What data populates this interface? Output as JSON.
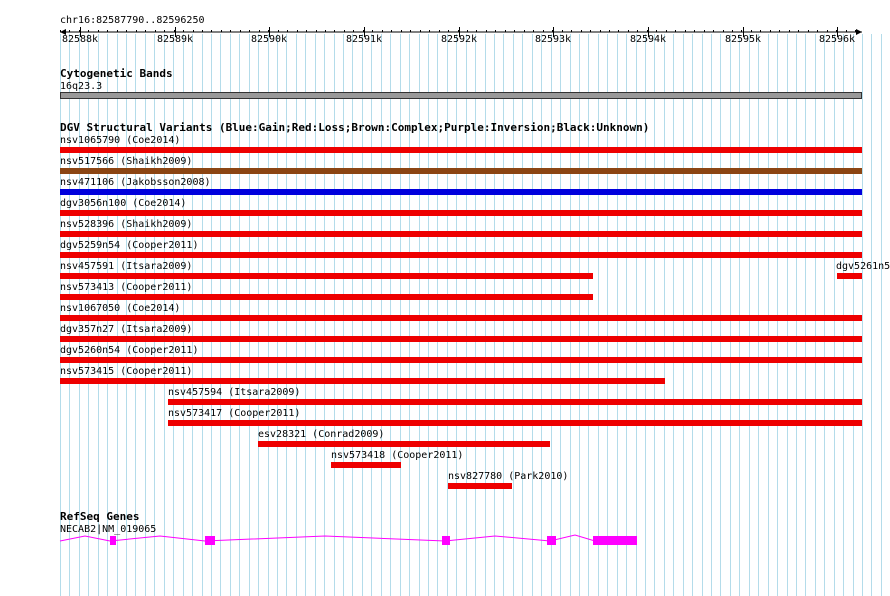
{
  "ruler": {
    "location": "chr16:82587790..82596250",
    "ticks": [
      "82588k",
      "82589k",
      "82590k",
      "82591k",
      "82592k",
      "82593k",
      "82594k",
      "82595k",
      "82596k"
    ]
  },
  "cytoband": {
    "title": "Cytogenetic Bands",
    "band": "16q23.3"
  },
  "dgv": {
    "title": "DGV Structural Variants (Blue:Gain;Red:Loss;Brown:Complex;Purple:Inversion;Black:Unknown)",
    "colors": {
      "loss": "#ee0000",
      "gain": "#0000dd",
      "complex": "#8b4513"
    },
    "variants": [
      {
        "label": "nsv1065790 (Coe2014)",
        "type": "loss"
      },
      {
        "label": "nsv517566 (Shaikh2009)",
        "type": "complex"
      },
      {
        "label": "nsv471106 (Jakobsson2008)",
        "type": "gain"
      },
      {
        "label": "dgv3056n100 (Coe2014)",
        "type": "loss"
      },
      {
        "label": "nsv528396 (Shaikh2009)",
        "type": "loss"
      },
      {
        "label": "dgv5259n54 (Cooper2011)",
        "type": "loss"
      },
      {
        "label": "nsv457591 (Itsara2009)",
        "type": "loss"
      },
      {
        "label": "dgv5261n5",
        "type": "loss"
      },
      {
        "label": "nsv573413 (Cooper2011)",
        "type": "loss"
      },
      {
        "label": "nsv1067050 (Coe2014)",
        "type": "loss"
      },
      {
        "label": "dgv357n27 (Itsara2009)",
        "type": "loss"
      },
      {
        "label": "dgv5260n54 (Cooper2011)",
        "type": "loss"
      },
      {
        "label": "nsv573415 (Cooper2011)",
        "type": "loss"
      },
      {
        "label": "nsv457594 (Itsara2009)",
        "type": "loss"
      },
      {
        "label": "nsv573417 (Cooper2011)",
        "type": "loss"
      },
      {
        "label": "esv28321 (Conrad2009)",
        "type": "loss"
      },
      {
        "label": "nsv573418 (Cooper2011)",
        "type": "loss"
      },
      {
        "label": "nsv827780 (Park2010)",
        "type": "loss"
      }
    ]
  },
  "refseq": {
    "title": "RefSeq Genes",
    "gene": "NECAB2|NM_019065",
    "color": "#ff00ff"
  }
}
